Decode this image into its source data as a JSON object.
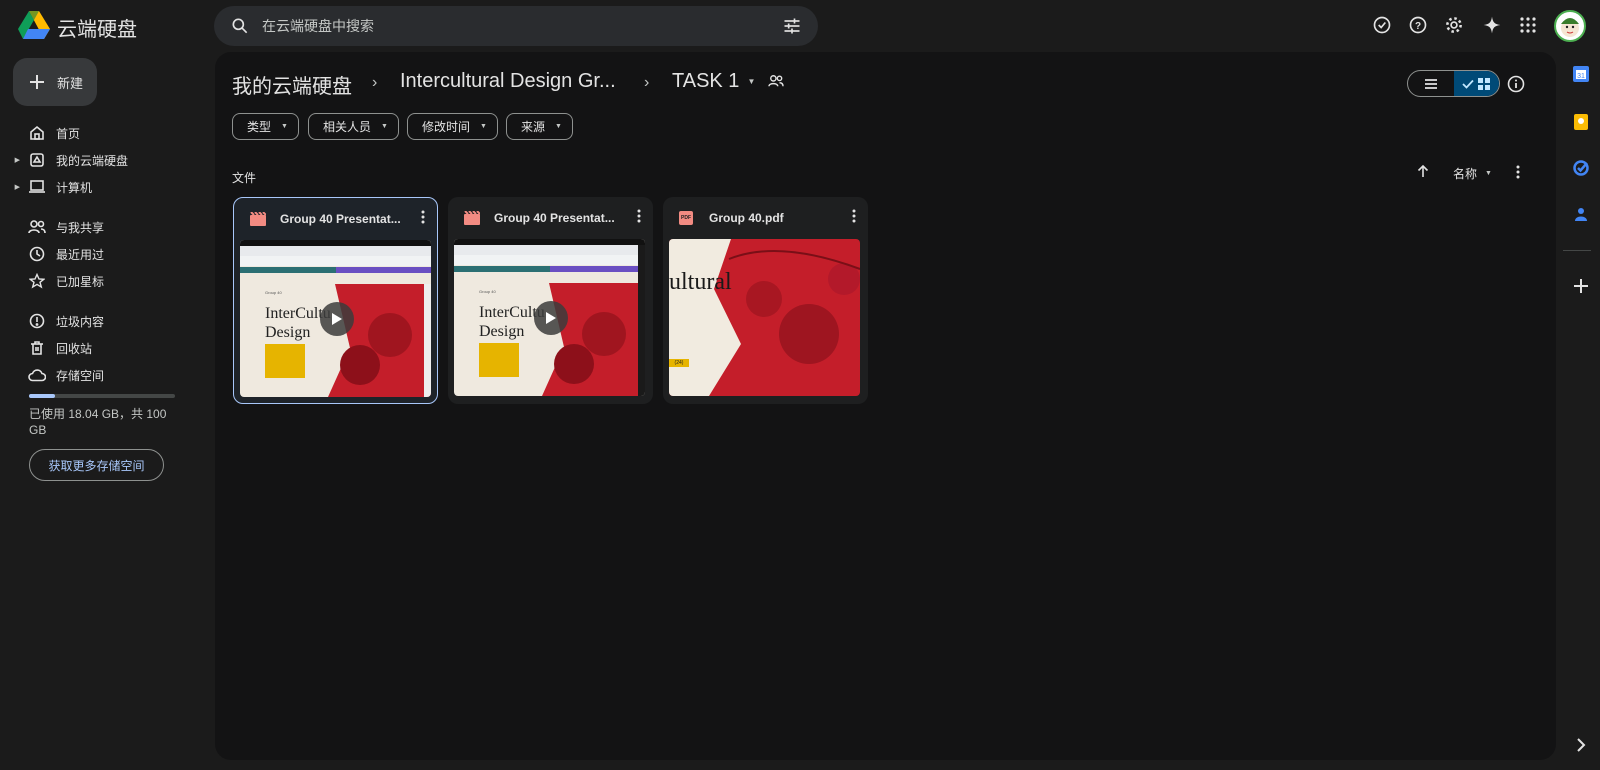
{
  "app": {
    "title": "云端硬盘"
  },
  "search": {
    "placeholder": "在云端硬盘中搜索"
  },
  "sidebar": {
    "new_label": "新建",
    "items": [
      {
        "label": "首页",
        "icon": "home-icon"
      },
      {
        "label": "我的云端硬盘",
        "icon": "my-drive-icon"
      },
      {
        "label": "计算机",
        "icon": "computer-icon"
      },
      {
        "label": "与我共享",
        "icon": "shared-icon"
      },
      {
        "label": "最近用过",
        "icon": "clock-icon"
      },
      {
        "label": "已加星标",
        "icon": "star-icon"
      },
      {
        "label": "垃圾内容",
        "icon": "spam-icon"
      },
      {
        "label": "回收站",
        "icon": "trash-icon"
      },
      {
        "label": "存储空间",
        "icon": "cloud-icon"
      }
    ],
    "storage": {
      "used_fraction": 0.18,
      "text": "已使用 18.04 GB，共 100 GB",
      "button": "获取更多存储空间"
    }
  },
  "breadcrumb": {
    "root": "我的云端硬盘",
    "parent": "Intercultural Design Gr...",
    "current": "TASK 1"
  },
  "filters": [
    "类型",
    "相关人员",
    "修改时间",
    "来源"
  ],
  "section": {
    "label": "文件"
  },
  "sort": {
    "label": "名称"
  },
  "files": [
    {
      "name": "Group 40 Presentat...",
      "type": "video"
    },
    {
      "name": "Group 40 Presentat...",
      "type": "video"
    },
    {
      "name": "Group 40.pdf",
      "type": "pdf",
      "badge": "PDF"
    }
  ],
  "thumbnail": {
    "heading_line1": "InterCultu",
    "heading_line2": "Design",
    "pdf_text": "ultural",
    "tag": "Group 40",
    "pdf_tag": "(24)"
  },
  "colors": {
    "accent": "#a8c7fa",
    "panel": "#131314",
    "bg": "#1b1b1b"
  }
}
